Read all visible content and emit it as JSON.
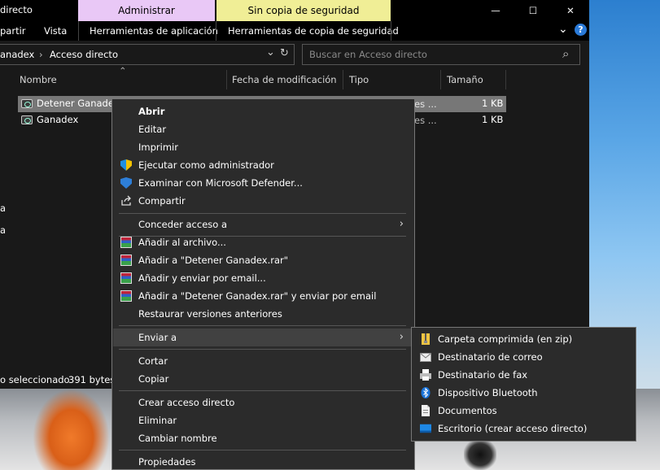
{
  "window": {
    "title": "directo",
    "context_tabs": {
      "admin": "Administrar",
      "backup": "Sin copia de seguridad"
    },
    "controls": {
      "minimize": "—",
      "maximize": "☐",
      "close": "✕"
    }
  },
  "ribbon": {
    "tabs": [
      "partir",
      "Vista",
      "Herramientas de aplicación",
      "Herramientas de copia de seguridad"
    ],
    "collapse_icon": "⌄",
    "help_icon": "?"
  },
  "address": {
    "crumbs": [
      "anadex",
      "Acceso directo"
    ],
    "separator": "›",
    "dropdown": "⌄",
    "refresh": "↻"
  },
  "search": {
    "placeholder": "Buscar en Acceso directo",
    "icon": "⌕"
  },
  "columns": {
    "name": "Nombre",
    "modified": "Fecha de modificación",
    "type": "Tipo",
    "size": "Tamaño",
    "sort_indicator": "⌃"
  },
  "files": [
    {
      "name": "Detener Ganadex",
      "type_partial": "es ...",
      "size": "1 KB",
      "selected": true
    },
    {
      "name": "Ganadex",
      "type_partial": "es ...",
      "size": "1 KB",
      "selected": false
    }
  ],
  "left_pane_partial": [
    "a",
    "a"
  ],
  "status": {
    "selection": "o seleccionado",
    "size": "391 bytes"
  },
  "context_menu": {
    "items": [
      {
        "label": "Abrir",
        "bold": true
      },
      {
        "label": "Editar"
      },
      {
        "label": "Imprimir"
      },
      {
        "label": "Ejecutar como administrador",
        "icon": "uac-shield-icon"
      },
      {
        "label": "Examinar con Microsoft Defender...",
        "icon": "defender-icon"
      },
      {
        "label": "Compartir",
        "icon": "share-icon"
      },
      {
        "label": "Conceder acceso a",
        "submenu": true
      },
      {
        "label": "Añadir al archivo...",
        "icon": "winrar-icon"
      },
      {
        "label": "Añadir a \"Detener Ganadex.rar\"",
        "icon": "winrar-icon"
      },
      {
        "label": "Añadir y enviar por email...",
        "icon": "winrar-icon"
      },
      {
        "label": "Añadir a \"Detener Ganadex.rar\" y enviar por email",
        "icon": "winrar-icon"
      },
      {
        "label": "Restaurar versiones anteriores"
      },
      {
        "label": "Enviar a",
        "submenu": true,
        "highlighted": true
      },
      {
        "label": "Cortar"
      },
      {
        "label": "Copiar"
      },
      {
        "label": "Crear acceso directo"
      },
      {
        "label": "Eliminar"
      },
      {
        "label": "Cambiar nombre"
      },
      {
        "label": "Propiedades"
      }
    ],
    "submenu_arrow": "›"
  },
  "send_to_menu": {
    "items": [
      {
        "label": "Carpeta comprimida (en zip)",
        "icon": "zip-folder-icon"
      },
      {
        "label": "Destinatario de correo",
        "icon": "mail-icon"
      },
      {
        "label": "Destinatario de fax",
        "icon": "fax-icon"
      },
      {
        "label": "Dispositivo Bluetooth",
        "icon": "bluetooth-icon"
      },
      {
        "label": "Documentos",
        "icon": "documents-icon"
      },
      {
        "label": "Escritorio (crear acceso directo)",
        "icon": "desktop-icon"
      }
    ]
  }
}
